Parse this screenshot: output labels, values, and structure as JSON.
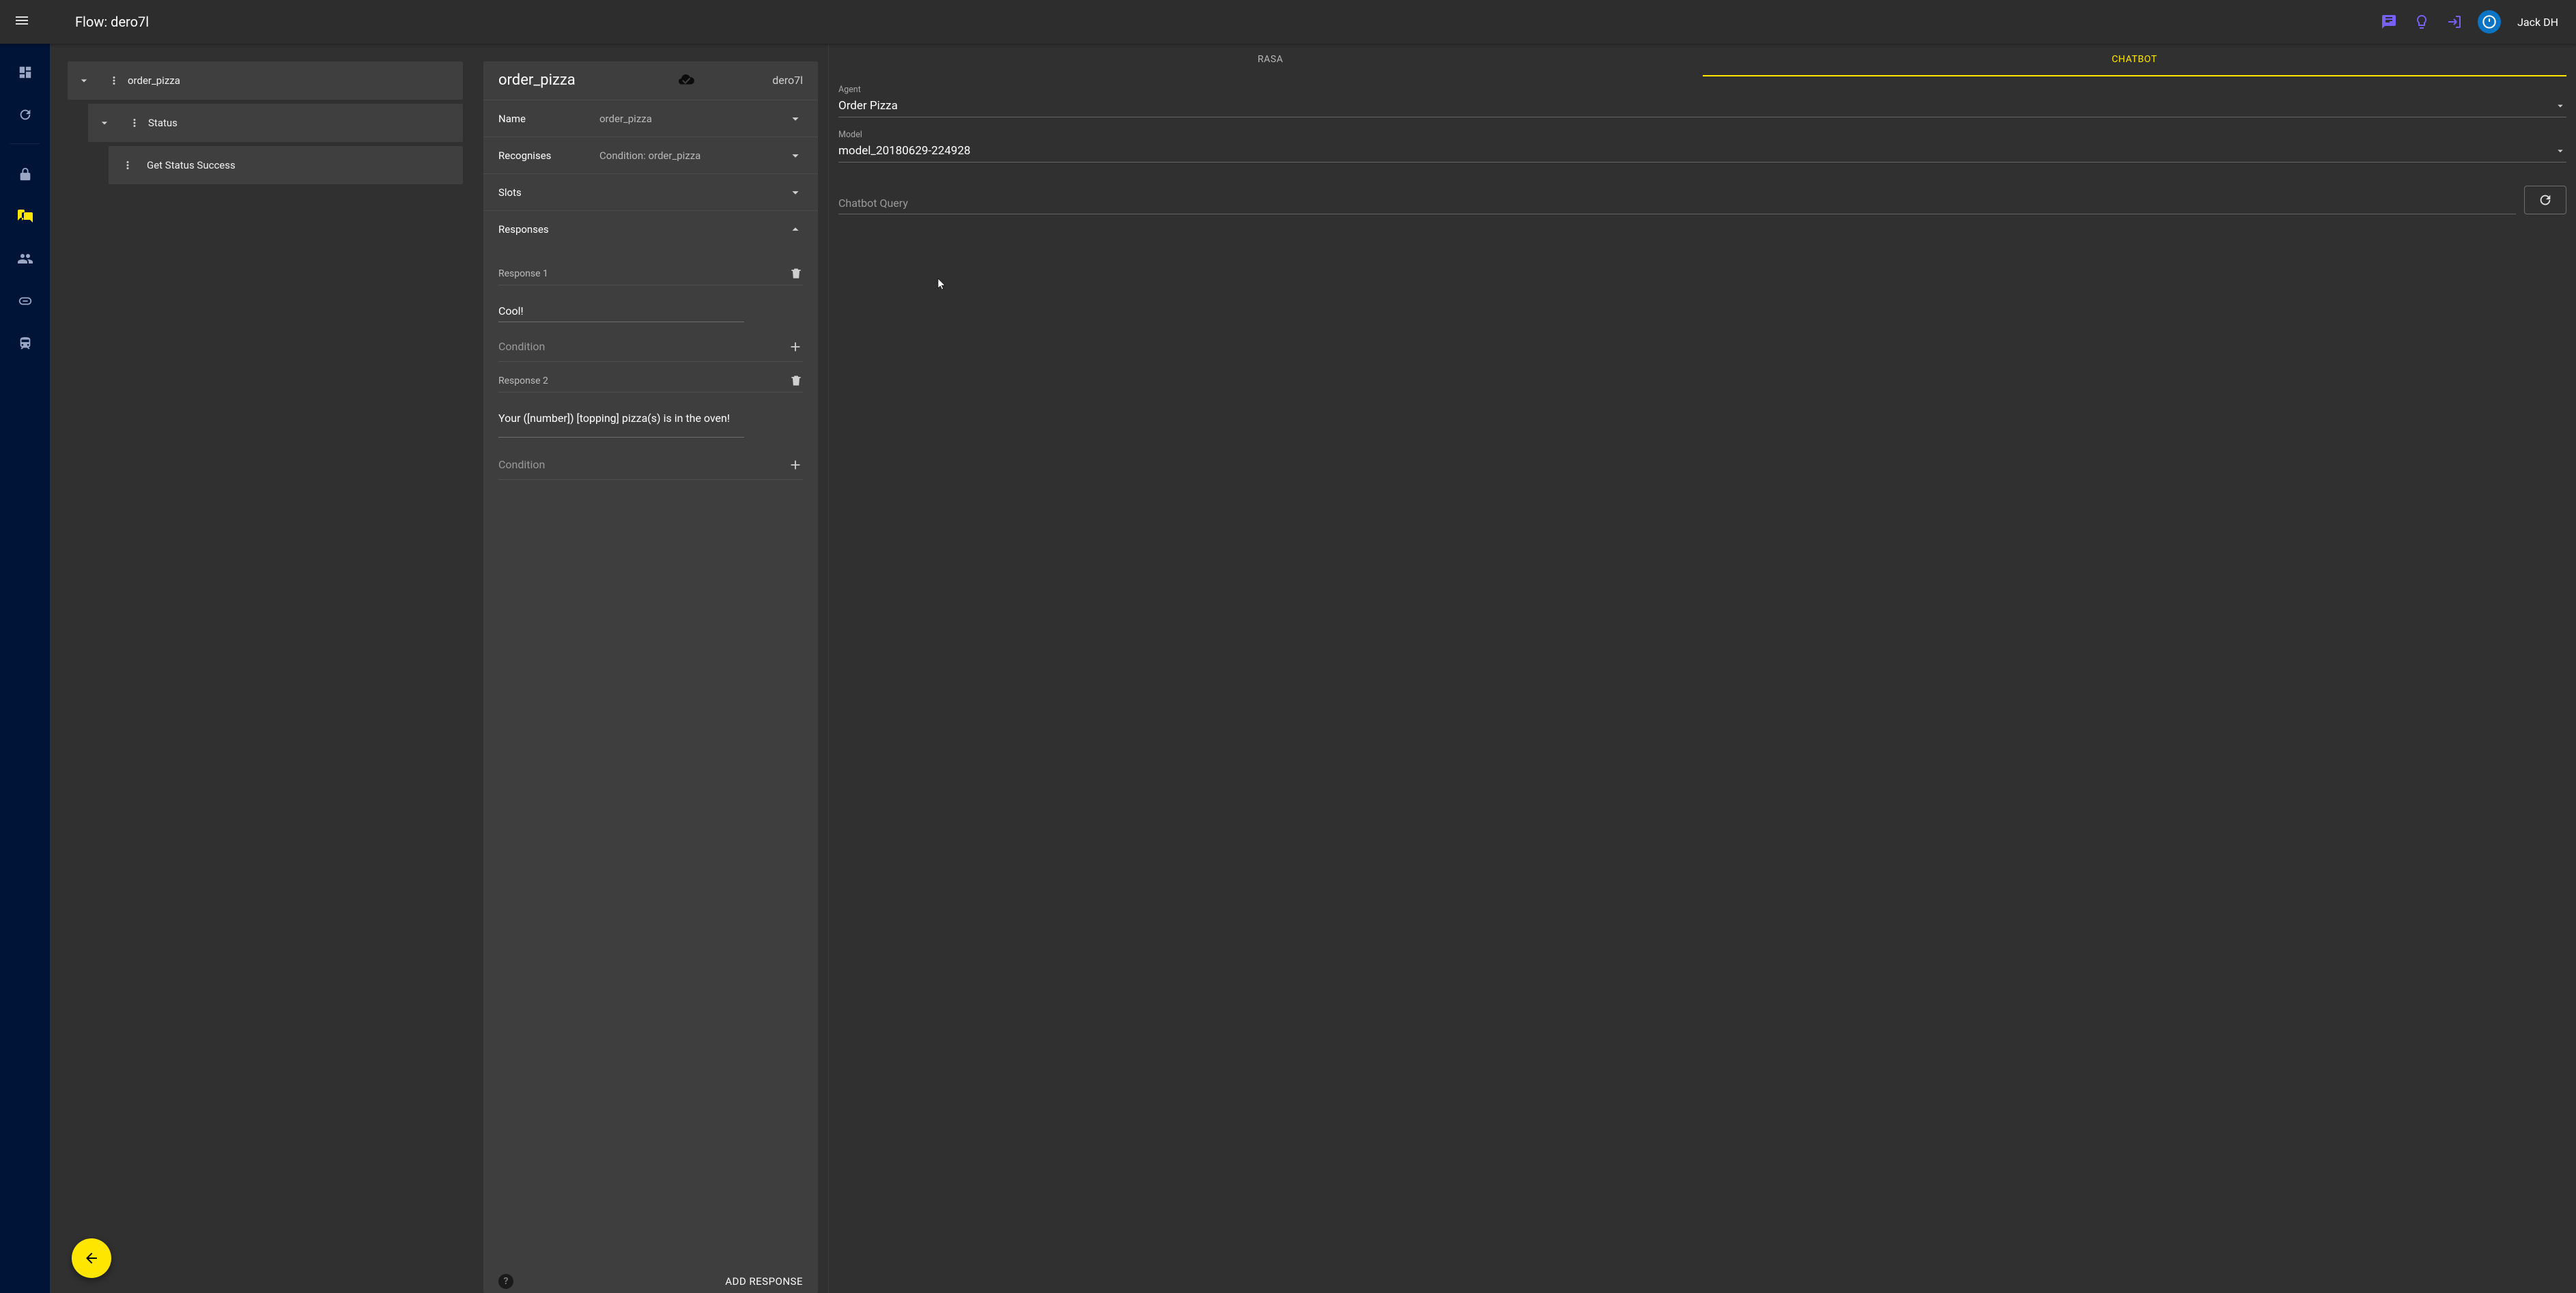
{
  "header": {
    "title": "Flow: dero7l",
    "username": "Jack DH"
  },
  "tree": {
    "items": [
      {
        "label": "order_pizza"
      },
      {
        "label": "Status"
      },
      {
        "label": "Get Status Success"
      }
    ]
  },
  "detail": {
    "title": "order_pizza",
    "flow_tag": "dero7l",
    "name_label": "Name",
    "name_value": "order_pizza",
    "recognises_label": "Recognises",
    "recognises_value": "Condition: order_pizza",
    "slots_label": "Slots",
    "responses_label": "Responses",
    "response1_label": "Response 1",
    "response1_text": "Cool!",
    "condition_placeholder": "Condition",
    "response2_label": "Response 2",
    "response2_text": "Your ([number]) [topping] pizza(s) is in the oven!",
    "add_response_label": "ADD RESPONSE",
    "help_symbol": "?"
  },
  "right": {
    "tabs": {
      "rasa": "RASA",
      "chatbot": "CHATBOT"
    },
    "agent_label": "Agent",
    "agent_value": "Order Pizza",
    "model_label": "Model",
    "model_value": "model_20180629-224928",
    "query_placeholder": "Chatbot Query"
  }
}
